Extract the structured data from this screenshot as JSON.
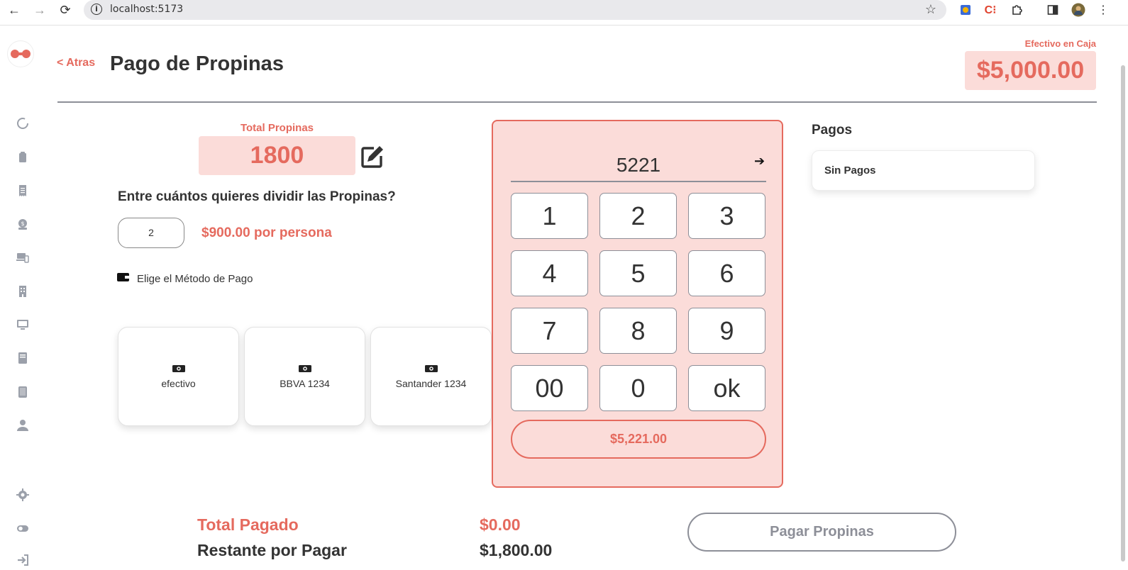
{
  "browser": {
    "url": "localhost:5173"
  },
  "header": {
    "back_label": "< Atras",
    "title": "Pago de Propinas",
    "cash_label": "Efectivo en Caja",
    "cash_value": "$5,000.00"
  },
  "tips": {
    "total_label": "Total Propinas",
    "total_value": "1800",
    "divide_question": "Entre cuántos quieres dividir las Propinas?",
    "divide_value": "2",
    "per_person": "$900.00 por persona",
    "method_label": "Elige el Método de Pago",
    "methods": [
      {
        "label": "efectivo"
      },
      {
        "label": "BBVA 1234"
      },
      {
        "label": "Santander 1234"
      }
    ]
  },
  "keypad": {
    "display": "5221",
    "keys": [
      "1",
      "2",
      "3",
      "4",
      "5",
      "6",
      "7",
      "8",
      "9",
      "00",
      "0",
      "ok"
    ],
    "total": "$5,221.00"
  },
  "payments": {
    "title": "Pagos",
    "empty_text": "Sin Pagos"
  },
  "summary": {
    "paid_label": "Total Pagado",
    "paid_value": "$0.00",
    "remaining_label": "Restante por Pagar",
    "remaining_value": "$1,800.00",
    "pay_button": "Pagar Propinas"
  },
  "colors": {
    "accent": "#e56a5e",
    "accent_light": "#fbdcd9",
    "text": "#333333",
    "muted": "#8d8f98"
  },
  "sidebar": {
    "icons": [
      "loader-icon",
      "clipboard-icon",
      "receipt-icon",
      "money-bag-icon",
      "devices-icon",
      "building-icon",
      "monitor-icon",
      "book-icon",
      "tablet-icon",
      "user-icon",
      "gear-icon",
      "toggle-icon",
      "logout-icon"
    ]
  }
}
